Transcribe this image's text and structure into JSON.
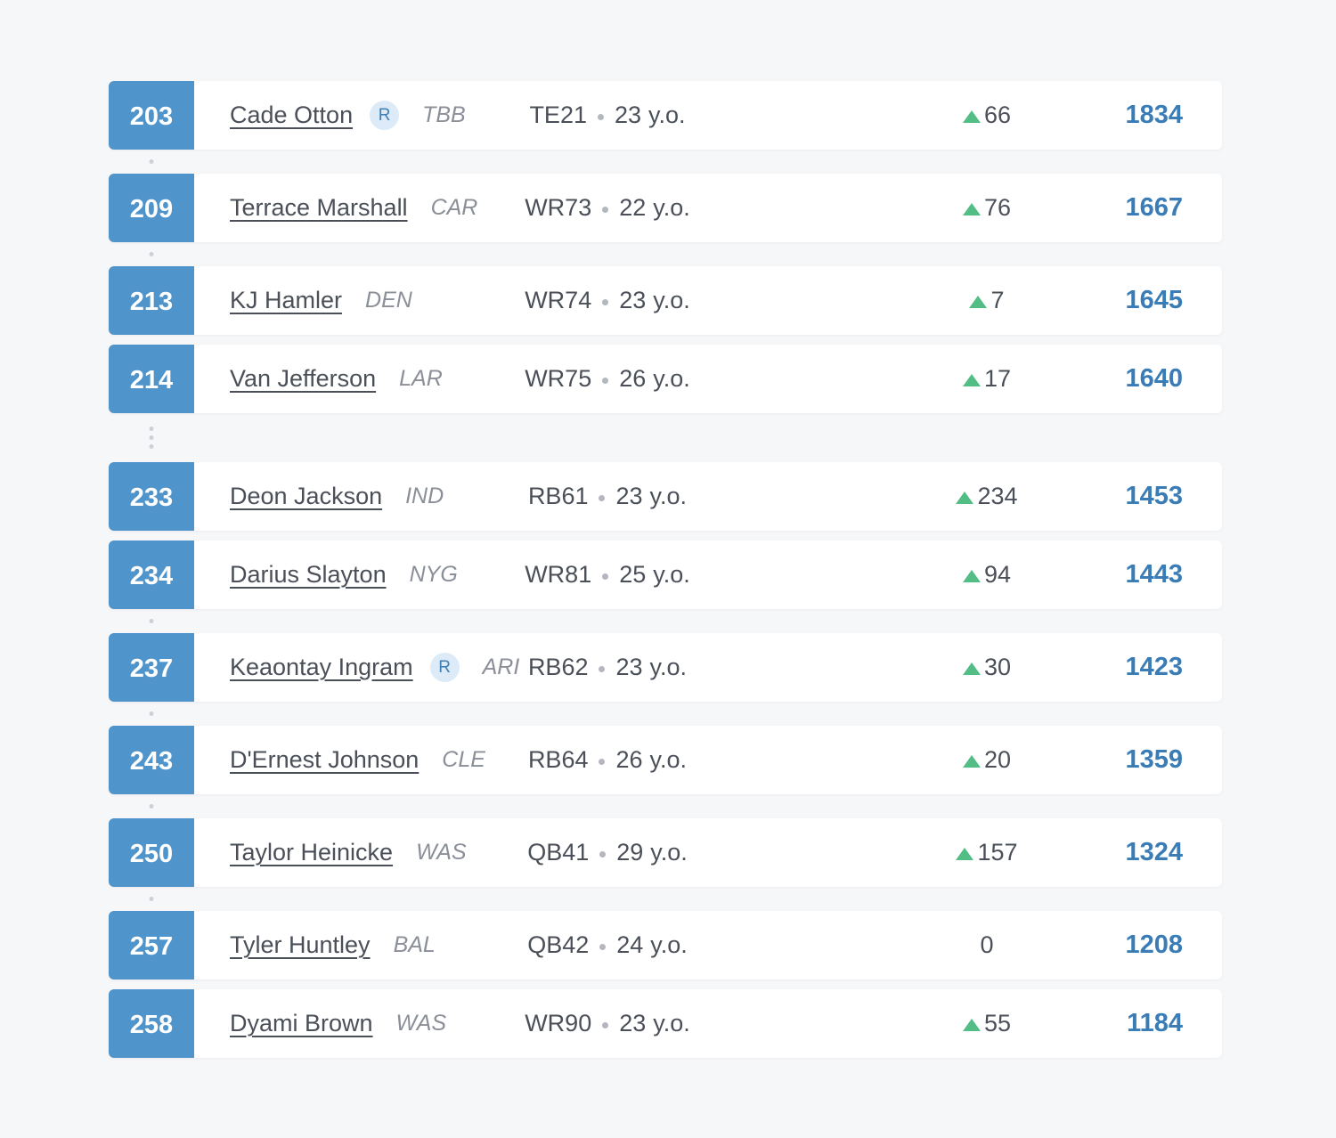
{
  "colors": {
    "rank_bg": "#4f95cc",
    "value_text": "#3a7db6",
    "trend_up": "#52bd84",
    "rookie_badge_bg": "#dcebf7"
  },
  "rookie_label": "R",
  "age_suffix": "y.o.",
  "players": [
    {
      "rank": "203",
      "name": "Cade Otton",
      "rookie": true,
      "team": "TBB",
      "position": "TE21",
      "age": "23",
      "trend": "66",
      "trend_dir": "up",
      "value": "1834",
      "gap_after": 1
    },
    {
      "rank": "209",
      "name": "Terrace Marshall",
      "rookie": false,
      "team": "CAR",
      "position": "WR73",
      "age": "22",
      "trend": "76",
      "trend_dir": "up",
      "value": "1667",
      "gap_after": 1
    },
    {
      "rank": "213",
      "name": "KJ Hamler",
      "rookie": false,
      "team": "DEN",
      "position": "WR74",
      "age": "23",
      "trend": "7",
      "trend_dir": "up",
      "value": "1645",
      "gap_after": 0
    },
    {
      "rank": "214",
      "name": "Van Jefferson",
      "rookie": false,
      "team": "LAR",
      "position": "WR75",
      "age": "26",
      "trend": "17",
      "trend_dir": "up",
      "value": "1640",
      "gap_after": 3
    },
    {
      "rank": "233",
      "name": "Deon Jackson",
      "rookie": false,
      "team": "IND",
      "position": "RB61",
      "age": "23",
      "trend": "234",
      "trend_dir": "up",
      "value": "1453",
      "gap_after": 0
    },
    {
      "rank": "234",
      "name": "Darius Slayton",
      "rookie": false,
      "team": "NYG",
      "position": "WR81",
      "age": "25",
      "trend": "94",
      "trend_dir": "up",
      "value": "1443",
      "gap_after": 1
    },
    {
      "rank": "237",
      "name": "Keaontay Ingram",
      "rookie": true,
      "team": "ARI",
      "position": "RB62",
      "age": "23",
      "trend": "30",
      "trend_dir": "up",
      "value": "1423",
      "gap_after": 1
    },
    {
      "rank": "243",
      "name": "D'Ernest Johnson",
      "rookie": false,
      "team": "CLE",
      "position": "RB64",
      "age": "26",
      "trend": "20",
      "trend_dir": "up",
      "value": "1359",
      "gap_after": 1
    },
    {
      "rank": "250",
      "name": "Taylor Heinicke",
      "rookie": false,
      "team": "WAS",
      "position": "QB41",
      "age": "29",
      "trend": "157",
      "trend_dir": "up",
      "value": "1324",
      "gap_after": 1
    },
    {
      "rank": "257",
      "name": "Tyler Huntley",
      "rookie": false,
      "team": "BAL",
      "position": "QB42",
      "age": "24",
      "trend": "0",
      "trend_dir": "none",
      "value": "1208",
      "gap_after": 0
    },
    {
      "rank": "258",
      "name": "Dyami Brown",
      "rookie": false,
      "team": "WAS",
      "position": "WR90",
      "age": "23",
      "trend": "55",
      "trend_dir": "up",
      "value": "1184",
      "gap_after": null
    }
  ]
}
